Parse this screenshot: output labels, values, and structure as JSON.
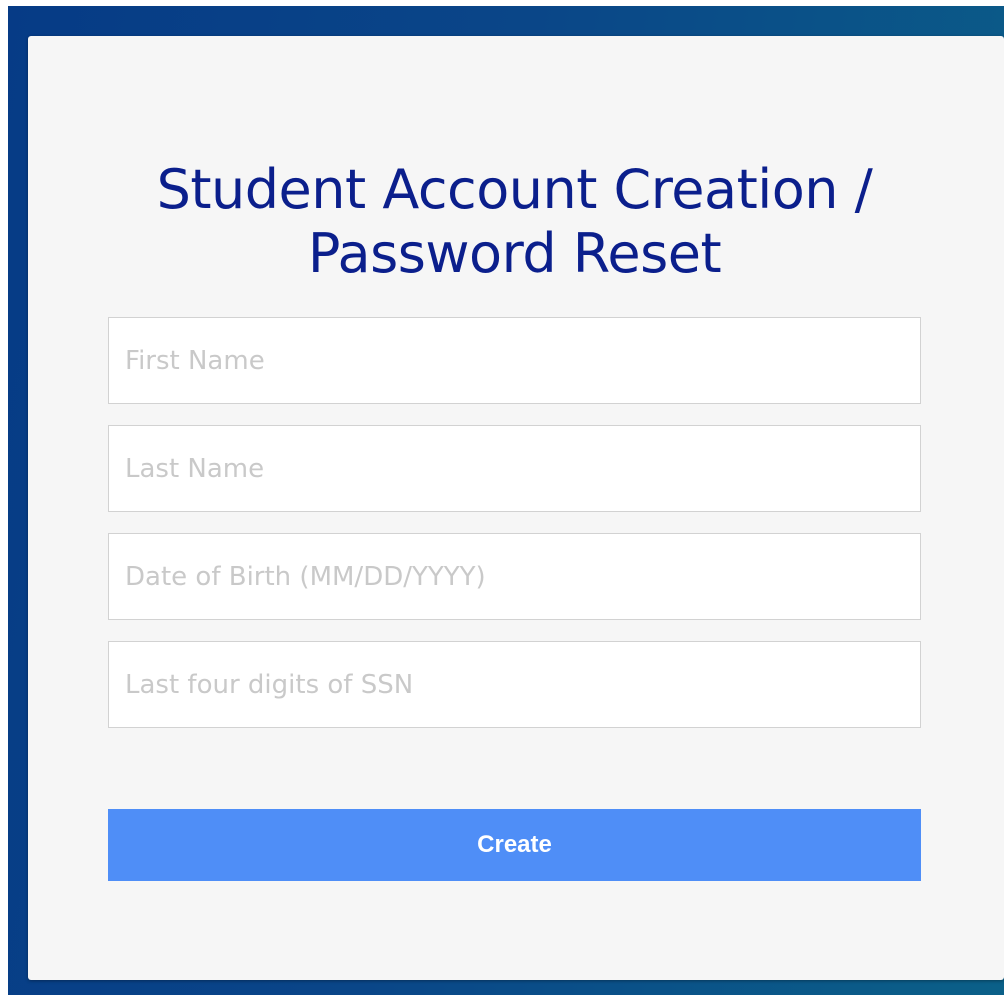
{
  "form": {
    "title": "Student Account Creation / Password Reset",
    "fields": [
      {
        "name": "first-name",
        "placeholder": "First Name",
        "value": ""
      },
      {
        "name": "last-name",
        "placeholder": "Last Name",
        "value": ""
      },
      {
        "name": "date-of-birth",
        "placeholder": "Date of Birth (MM/DD/YYYY)",
        "value": ""
      },
      {
        "name": "ssn-last-four",
        "placeholder": "Last four digits of SSN",
        "value": ""
      }
    ],
    "submit_label": "Create"
  },
  "colors": {
    "title": "#0b1f8c",
    "button": "#4f8ef7",
    "card_background": "#f6f6f6",
    "backdrop": "#0a4688",
    "placeholder_text": "#c9c9c9"
  }
}
